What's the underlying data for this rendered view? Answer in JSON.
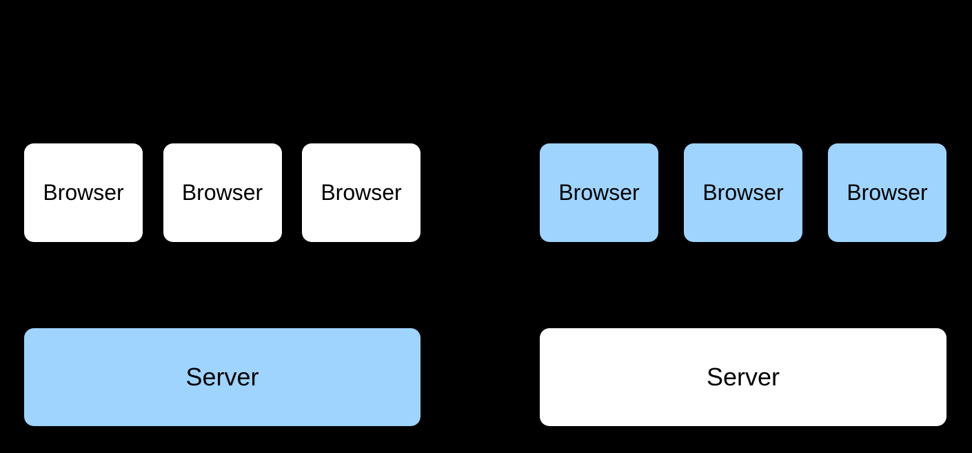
{
  "left": {
    "browsers": [
      "Browser",
      "Browser",
      "Browser"
    ],
    "server": "Server",
    "highlight": "server"
  },
  "right": {
    "browsers": [
      "Browser",
      "Browser",
      "Browser"
    ],
    "server": "Server",
    "highlight": "browsers"
  },
  "colors": {
    "background": "#000000",
    "box_white": "#ffffff",
    "box_blue": "#9fd4ff"
  }
}
